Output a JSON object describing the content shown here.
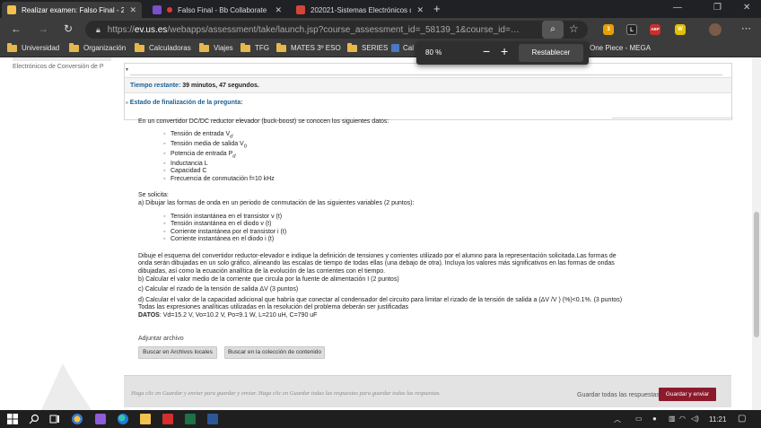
{
  "browser": {
    "tabs": [
      {
        "title": "Realizar examen: Falso Final - 2…",
        "active": true,
        "favicon_color": "#f2c14e"
      },
      {
        "title": "Falso Final - Bb Collaborate",
        "active": false,
        "favicon_color": "#7b4fc9"
      },
      {
        "title": "202021-Sistemas Electrónicos de…",
        "active": false,
        "favicon_color": "#d44638"
      }
    ],
    "new_tab": "+",
    "url_host": "ev.us.es",
    "url_scheme": "https://",
    "url_path": "/webapps/assessment/take/launch.jsp?course_assessment_id=_58139_1&course_id=…",
    "zoom": {
      "level": "80 %",
      "minus": "−",
      "plus": "+",
      "reset_label": "Restablecer"
    },
    "bookmarks": [
      "Universidad",
      "Organización",
      "Calculadoras",
      "Viajes",
      "TFG",
      "MATES 3º ESO",
      "SERIES",
      "Cal",
      "One Piece - MEGA"
    ],
    "extensions": [
      {
        "name": "tampermonkey-icon",
        "color": "#e5a100",
        "text": "3"
      },
      {
        "name": "letter-l-icon",
        "color": "#222222",
        "text": "L"
      },
      {
        "name": "adblock-icon",
        "color": "#c9302c",
        "text": "ABP"
      },
      {
        "name": "letter-w-icon",
        "color": "#e3c000",
        "text": "W"
      }
    ]
  },
  "sidebar": {
    "course_name": "Electrónicos de Conversión de P"
  },
  "assessment": {
    "time_label": "Tiempo restante:",
    "time_value": "39 minutos, 47 segundos.",
    "status_label": "Estado de finalización de la pregunta:"
  },
  "question": {
    "intro": "En un convertidor DC/DC reductor elevador (buck-boost) se conocen los siguientes datos:",
    "data_list": [
      "Tensión de entrada V",
      "Tensión media de salida V",
      "Potencia de entrada P",
      "Inductancia L",
      "Capacidad C",
      "Frecuencia de conmutación f=10 kHz"
    ],
    "data_subs": [
      "d",
      "0",
      "d",
      "",
      "",
      "s"
    ],
    "solicita": "Se solicita:",
    "part_a": "a) Dibujar las formas de onda en un periodo de conmutación de las siguientes variables (2 puntos):",
    "wave_list": [
      "Tensión instantánea en el transistor v (t)",
      "Tensión instantánea en el diodo v (t)",
      "Corriente instantánea por el transistor i (t)",
      "Corriente instantánea en el diodo i (t)"
    ],
    "wave_subs": [
      "S",
      "D",
      "S",
      "D"
    ],
    "schema_text": "Dibuje el esquema del convertidor reductor-elevador e indique la definición de tensiones y corrientes utilizado por el alumno para la representación solicitada.Las formas de onda serán dibujadas en un solo gráfico, alineando las escalas de tiempo de todas ellas (una debajo de otra). Incluya los valores más significativos en las formas de ondas dibujadas, así como la ecuación analítica de la evolución de las corrientes con el tiempo.",
    "part_b": "b) Calcular el valor medio de la corriente que circula por la fuente de alimentación I (2 puntos)",
    "part_b_sub": "d",
    "part_c": "c) Calcular el rizado de la tensión de salida ΔV  (3 puntos)",
    "part_c_sub": "0",
    "part_d": "d) Calcular el valor de la capacidad adicional que habría que conectar al condensador del circuito para limitar el rizado de la tensión de salida a (ΔV /V ) (%)<0.1%. (3 puntos)",
    "note": "Todas las expresiones analíticas utilizadas en la resolución del problema deberán ser justificadas",
    "datos_label": "DATOS",
    "datos_value": ": Vd=15.2 V, Vo=10.2 V, Po=9.1 W, L=210 uH, C=790 uF"
  },
  "upload": {
    "label": "Adjuntar archivo",
    "local_button": "Buscar en Archivos locales",
    "collection_button": "Buscar en la colección de contenido"
  },
  "footer": {
    "hint": "Haga clic en Guardar y enviar para guardar y enviar. Haga clic en Guardar todas las respuestas para guardar todas las respuestas.",
    "save_all": "Guardar todas las respuestas",
    "submit": "Guardar y enviar"
  },
  "taskbar": {
    "time": "11:21"
  }
}
